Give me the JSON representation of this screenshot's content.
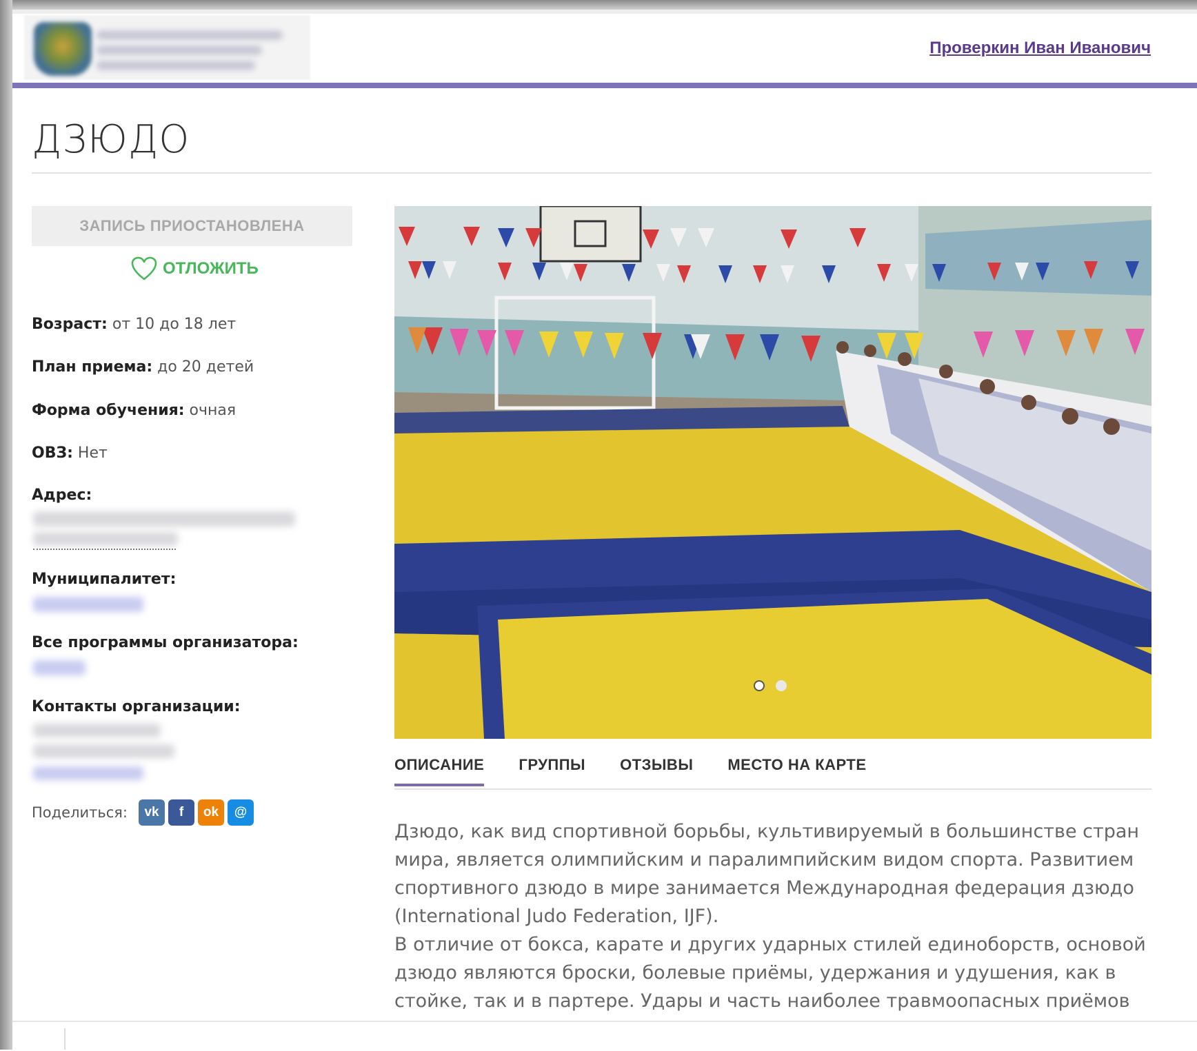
{
  "header": {
    "user_name": "Проверкин Иван Иванович"
  },
  "page": {
    "title": "ДЗЮДО"
  },
  "sidebar": {
    "status": "ЗАПИСЬ ПРИОСТАНОВЛЕНА",
    "postpone_label": "ОТЛОЖИТЬ",
    "age_label": "Возраст:",
    "age_value": "от 10 до 18 лет",
    "plan_label": "План приема:",
    "plan_value": "до 20 детей",
    "form_label": "Форма обучения:",
    "form_value": "очная",
    "ovz_label": "ОВЗ:",
    "ovz_value": "Нет",
    "address_label": "Адрес:",
    "municipality_label": "Муниципалитет:",
    "programs_label": "Все программы организатора:",
    "contacts_label": "Контакты организации:",
    "share_label": "Поделиться:"
  },
  "social": [
    {
      "name": "vk-icon",
      "glyph": "vk",
      "color": "#4a76a8"
    },
    {
      "name": "facebook-icon",
      "glyph": "f",
      "color": "#3b5998"
    },
    {
      "name": "odnoklassniki-icon",
      "glyph": "ok",
      "color": "#ee8208"
    },
    {
      "name": "moimir-icon",
      "glyph": "@",
      "color": "#168de2"
    }
  ],
  "slider": {
    "slide_count": 2,
    "active_slide": 1
  },
  "tabs": [
    {
      "label": "ОПИСАНИЕ",
      "active": true
    },
    {
      "label": "ГРУППЫ",
      "active": false
    },
    {
      "label": "ОТЗЫВЫ",
      "active": false
    },
    {
      "label": "МЕСТО НА КАРТЕ",
      "active": false
    }
  ],
  "description": {
    "p1": "Дзюдо, как вид спортивной борьбы, культивируемый в большинстве стран мира, является олимпийским и паралимпийским видом спорта. Развитием спортивного дзюдо в мире занимается Международная федерация дзюдо (International Judo Federation, IJF).",
    "p2": "В отличие от бокса, карате и других ударных стилей единоборств, основой дзюдо являются броски, болевые приёмы, удержания и удушения, как в стойке, так и в партере. Удары и часть наиболее травмоопасных приёмов изучаются"
  },
  "colors": {
    "accent": "#7d74b8",
    "link": "#5b3a8c",
    "postpone": "#47b85a",
    "tab_underline": "#7d6ba8"
  }
}
